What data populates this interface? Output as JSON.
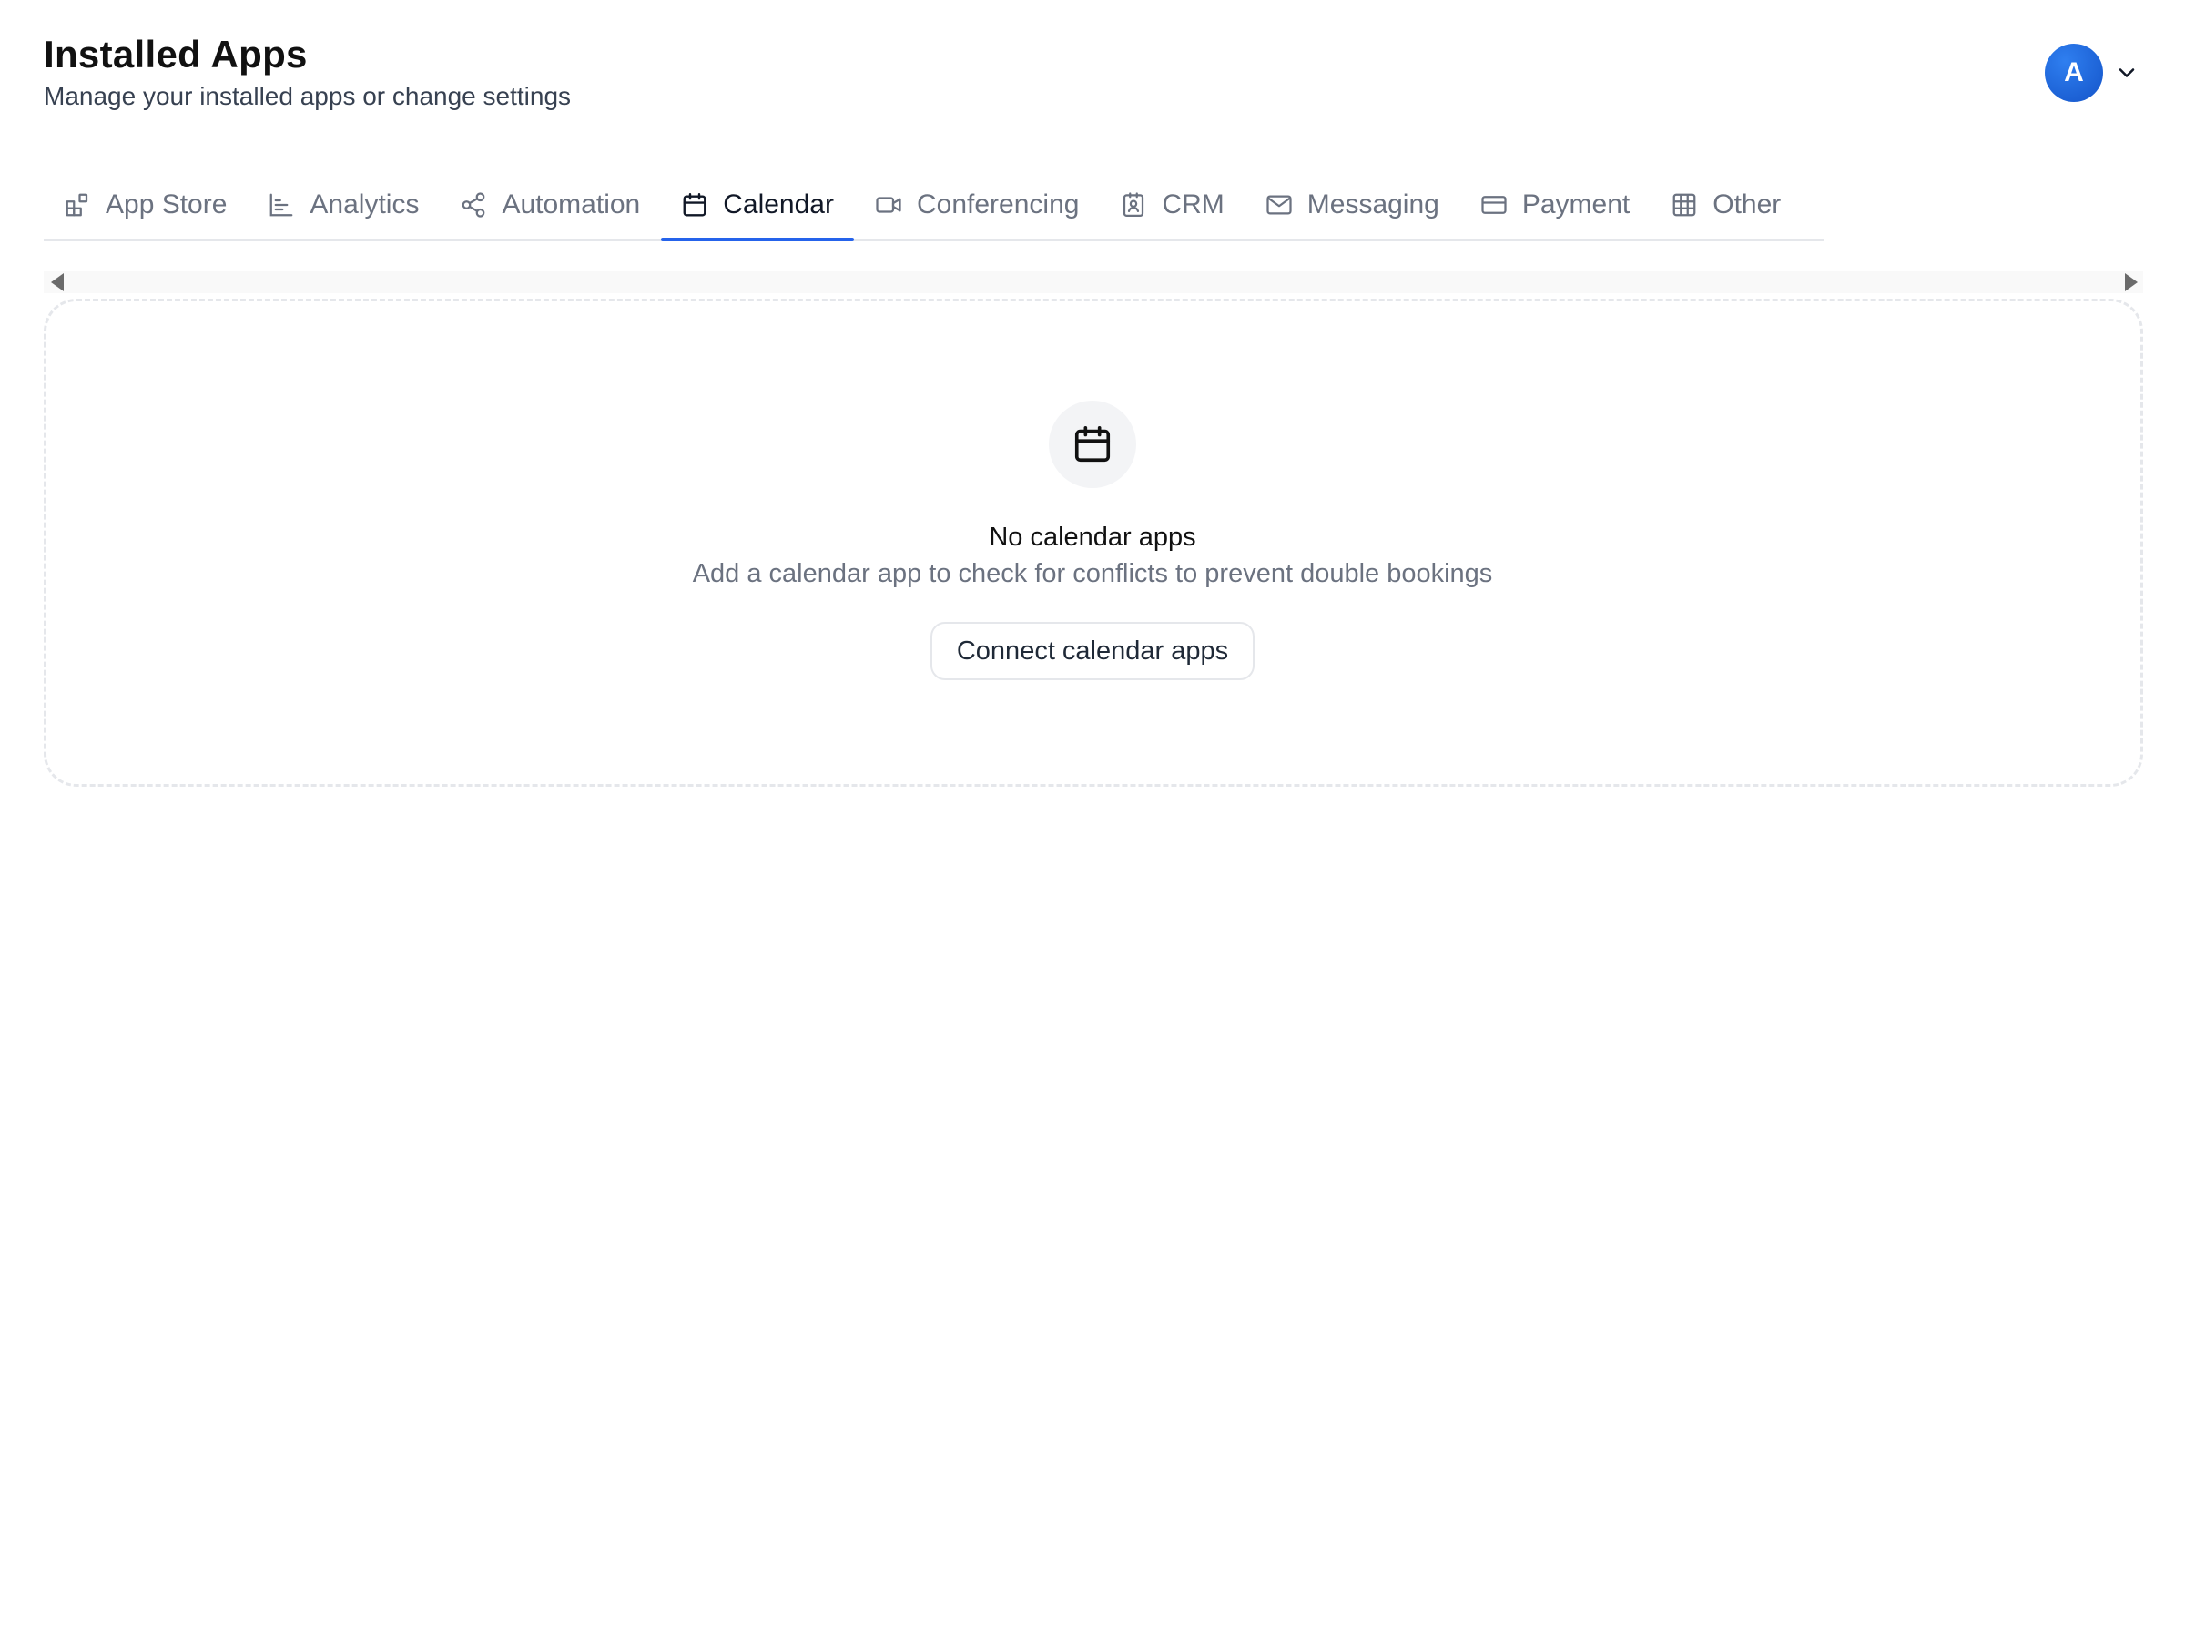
{
  "header": {
    "title": "Installed Apps",
    "subtitle": "Manage your installed apps or change settings"
  },
  "user": {
    "avatar_initial": "A",
    "avatar_color": "#1a62e0",
    "menu_icon": "chevron-down-icon"
  },
  "tabs": [
    {
      "label": "App Store",
      "icon": "app-store-icon",
      "active": false
    },
    {
      "label": "Analytics",
      "icon": "analytics-icon",
      "active": false
    },
    {
      "label": "Automation",
      "icon": "share-nodes-icon",
      "active": false
    },
    {
      "label": "Calendar",
      "icon": "calendar-icon",
      "active": true
    },
    {
      "label": "Conferencing",
      "icon": "video-icon",
      "active": false
    },
    {
      "label": "CRM",
      "icon": "contact-icon",
      "active": false
    },
    {
      "label": "Messaging",
      "icon": "mail-icon",
      "active": false
    },
    {
      "label": "Payment",
      "icon": "credit-card-icon",
      "active": false
    },
    {
      "label": "Other",
      "icon": "grid-icon",
      "active": false
    }
  ],
  "active_tab_color": "#2563eb",
  "empty_state": {
    "icon": "calendar-icon",
    "title": "No calendar apps",
    "description": "Add a calendar app to check for conflicts to prevent double bookings",
    "button_label": "Connect calendar apps"
  }
}
